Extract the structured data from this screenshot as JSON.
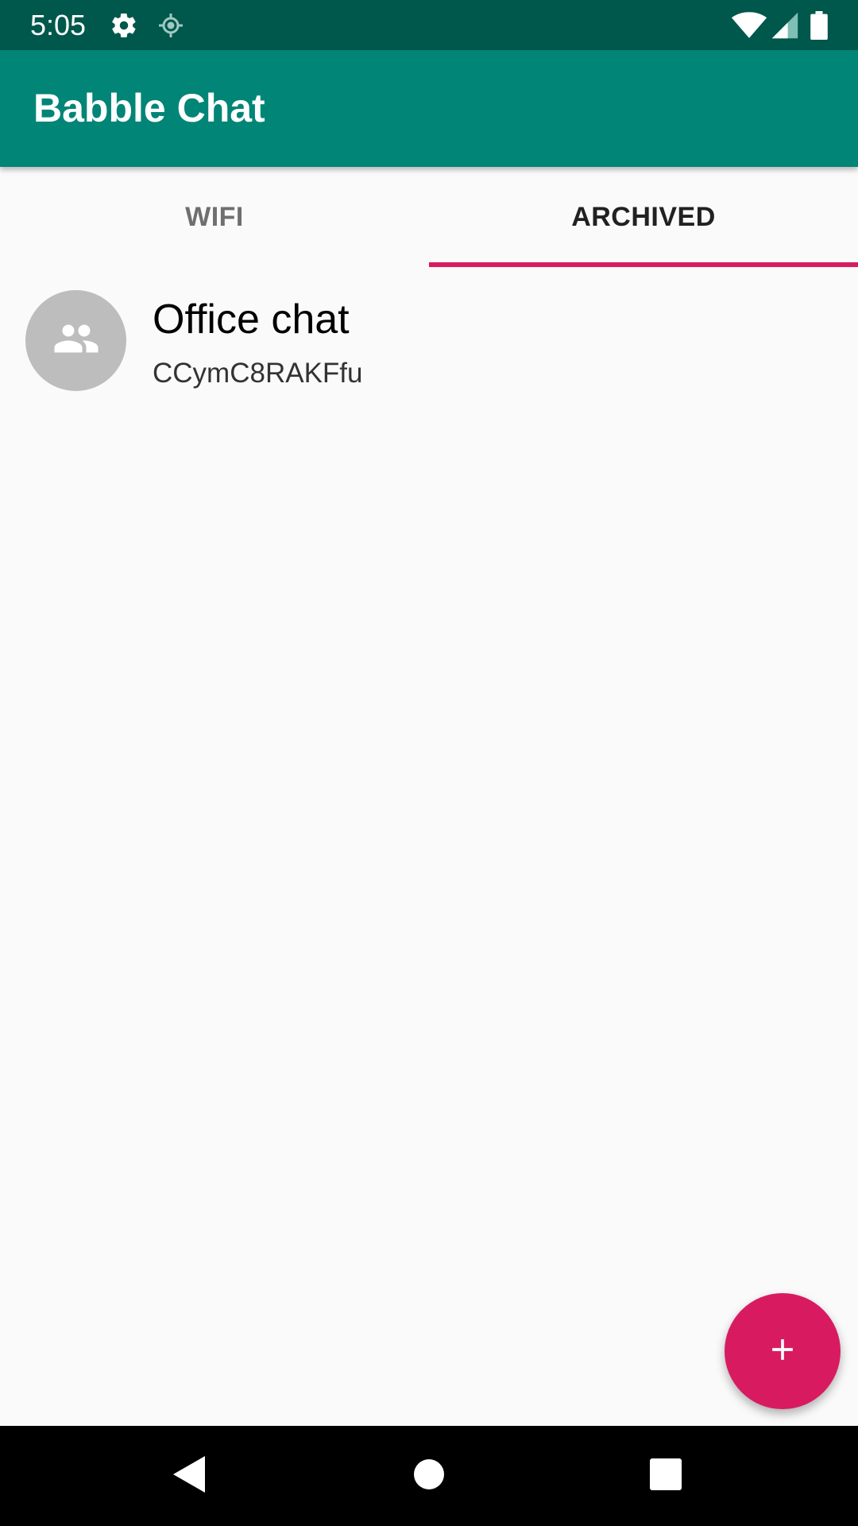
{
  "status_bar": {
    "time": "5:05",
    "icons": [
      "gear-icon",
      "location-icon",
      "wifi-icon",
      "signal-icon",
      "battery-icon"
    ]
  },
  "app_bar": {
    "title": "Babble Chat",
    "color": "#008577"
  },
  "tabs": [
    {
      "label": "WIFI",
      "selected": false
    },
    {
      "label": "ARCHIVED",
      "selected": true
    }
  ],
  "chats": [
    {
      "name": "Office chat",
      "id": "CCymC8RAKFfu",
      "icon": "group-icon"
    }
  ],
  "fab": {
    "icon": "plus-icon",
    "color": "#d81b60"
  },
  "nav_bar": {
    "icons": [
      "back-icon",
      "home-icon",
      "recents-icon"
    ]
  }
}
